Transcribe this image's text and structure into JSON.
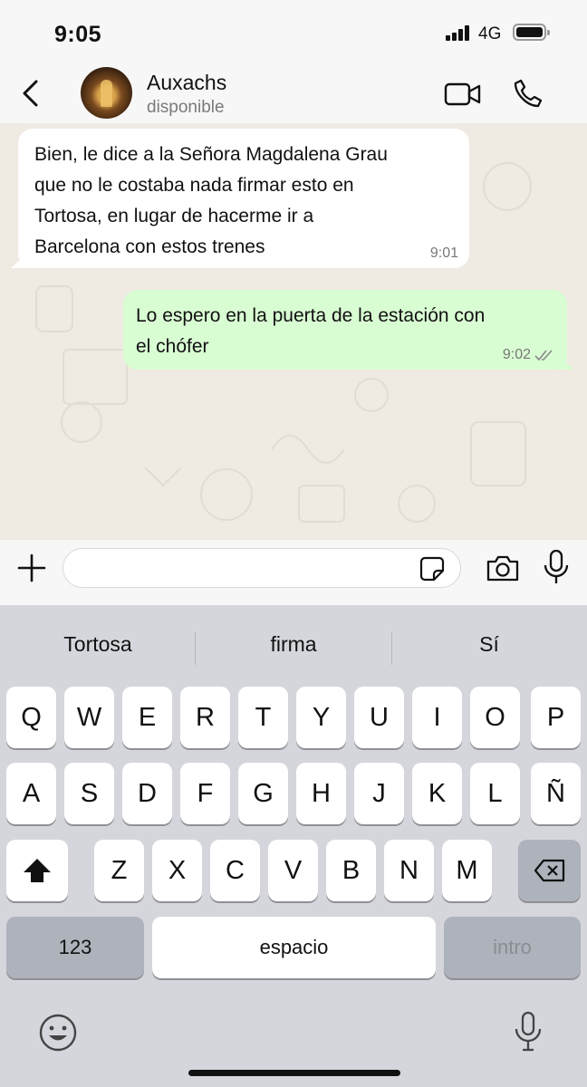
{
  "status_bar": {
    "time": "9:05",
    "network": "4G"
  },
  "header": {
    "contact_name": "Auxachs",
    "contact_status": "disponible"
  },
  "messages": [
    {
      "direction": "incoming",
      "text_lines": [
        "Bien, le dice a la Señora Magdalena Grau",
        "que no le costaba nada firmar esto en",
        "Tortosa, en lugar de hacerme ir a",
        "Barcelona con estos trenes"
      ],
      "time": "9:01"
    },
    {
      "direction": "outgoing",
      "text_lines": [
        "Lo espero en la puerta de la estación con",
        "el chófer"
      ],
      "time": "9:02",
      "status_icon": "double-check-icon"
    }
  ],
  "input": {
    "value": "",
    "placeholder": ""
  },
  "keyboard": {
    "suggestions": [
      "Tortosa",
      "firma",
      "Sí"
    ],
    "row1": [
      "Q",
      "W",
      "E",
      "R",
      "T",
      "Y",
      "U",
      "I",
      "O",
      "P"
    ],
    "row2": [
      "A",
      "S",
      "D",
      "F",
      "G",
      "H",
      "J",
      "K",
      "L",
      "Ñ"
    ],
    "row3": [
      "Z",
      "X",
      "C",
      "V",
      "B",
      "N",
      "M"
    ],
    "numbers_label": "123",
    "space_label": "espacio",
    "return_label": "intro"
  },
  "colors": {
    "incoming_bubble": "#ffffff",
    "outgoing_bubble": "#d9fdd3",
    "chat_background": "#efeae2",
    "read_ticks": "#8a8a8a"
  }
}
